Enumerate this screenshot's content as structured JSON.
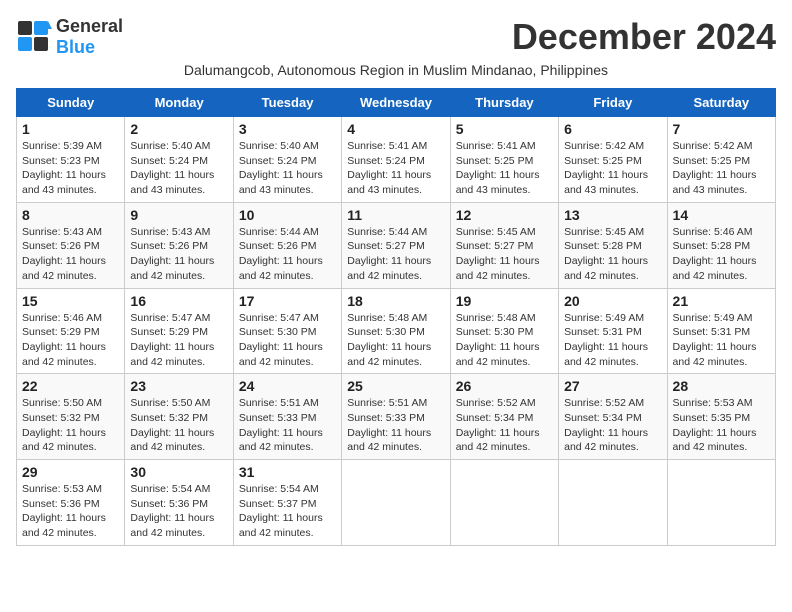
{
  "logo": {
    "general": "General",
    "blue": "Blue"
  },
  "title": "December 2024",
  "subtitle": "Dalumangcob, Autonomous Region in Muslim Mindanao, Philippines",
  "days_header": [
    "Sunday",
    "Monday",
    "Tuesday",
    "Wednesday",
    "Thursday",
    "Friday",
    "Saturday"
  ],
  "weeks": [
    [
      {
        "day": "1",
        "sunrise": "5:39 AM",
        "sunset": "5:23 PM",
        "daylight": "11 hours and 43 minutes."
      },
      {
        "day": "2",
        "sunrise": "5:40 AM",
        "sunset": "5:24 PM",
        "daylight": "11 hours and 43 minutes."
      },
      {
        "day": "3",
        "sunrise": "5:40 AM",
        "sunset": "5:24 PM",
        "daylight": "11 hours and 43 minutes."
      },
      {
        "day": "4",
        "sunrise": "5:41 AM",
        "sunset": "5:24 PM",
        "daylight": "11 hours and 43 minutes."
      },
      {
        "day": "5",
        "sunrise": "5:41 AM",
        "sunset": "5:25 PM",
        "daylight": "11 hours and 43 minutes."
      },
      {
        "day": "6",
        "sunrise": "5:42 AM",
        "sunset": "5:25 PM",
        "daylight": "11 hours and 43 minutes."
      },
      {
        "day": "7",
        "sunrise": "5:42 AM",
        "sunset": "5:25 PM",
        "daylight": "11 hours and 43 minutes."
      }
    ],
    [
      {
        "day": "8",
        "sunrise": "5:43 AM",
        "sunset": "5:26 PM",
        "daylight": "11 hours and 42 minutes."
      },
      {
        "day": "9",
        "sunrise": "5:43 AM",
        "sunset": "5:26 PM",
        "daylight": "11 hours and 42 minutes."
      },
      {
        "day": "10",
        "sunrise": "5:44 AM",
        "sunset": "5:26 PM",
        "daylight": "11 hours and 42 minutes."
      },
      {
        "day": "11",
        "sunrise": "5:44 AM",
        "sunset": "5:27 PM",
        "daylight": "11 hours and 42 minutes."
      },
      {
        "day": "12",
        "sunrise": "5:45 AM",
        "sunset": "5:27 PM",
        "daylight": "11 hours and 42 minutes."
      },
      {
        "day": "13",
        "sunrise": "5:45 AM",
        "sunset": "5:28 PM",
        "daylight": "11 hours and 42 minutes."
      },
      {
        "day": "14",
        "sunrise": "5:46 AM",
        "sunset": "5:28 PM",
        "daylight": "11 hours and 42 minutes."
      }
    ],
    [
      {
        "day": "15",
        "sunrise": "5:46 AM",
        "sunset": "5:29 PM",
        "daylight": "11 hours and 42 minutes."
      },
      {
        "day": "16",
        "sunrise": "5:47 AM",
        "sunset": "5:29 PM",
        "daylight": "11 hours and 42 minutes."
      },
      {
        "day": "17",
        "sunrise": "5:47 AM",
        "sunset": "5:30 PM",
        "daylight": "11 hours and 42 minutes."
      },
      {
        "day": "18",
        "sunrise": "5:48 AM",
        "sunset": "5:30 PM",
        "daylight": "11 hours and 42 minutes."
      },
      {
        "day": "19",
        "sunrise": "5:48 AM",
        "sunset": "5:30 PM",
        "daylight": "11 hours and 42 minutes."
      },
      {
        "day": "20",
        "sunrise": "5:49 AM",
        "sunset": "5:31 PM",
        "daylight": "11 hours and 42 minutes."
      },
      {
        "day": "21",
        "sunrise": "5:49 AM",
        "sunset": "5:31 PM",
        "daylight": "11 hours and 42 minutes."
      }
    ],
    [
      {
        "day": "22",
        "sunrise": "5:50 AM",
        "sunset": "5:32 PM",
        "daylight": "11 hours and 42 minutes."
      },
      {
        "day": "23",
        "sunrise": "5:50 AM",
        "sunset": "5:32 PM",
        "daylight": "11 hours and 42 minutes."
      },
      {
        "day": "24",
        "sunrise": "5:51 AM",
        "sunset": "5:33 PM",
        "daylight": "11 hours and 42 minutes."
      },
      {
        "day": "25",
        "sunrise": "5:51 AM",
        "sunset": "5:33 PM",
        "daylight": "11 hours and 42 minutes."
      },
      {
        "day": "26",
        "sunrise": "5:52 AM",
        "sunset": "5:34 PM",
        "daylight": "11 hours and 42 minutes."
      },
      {
        "day": "27",
        "sunrise": "5:52 AM",
        "sunset": "5:34 PM",
        "daylight": "11 hours and 42 minutes."
      },
      {
        "day": "28",
        "sunrise": "5:53 AM",
        "sunset": "5:35 PM",
        "daylight": "11 hours and 42 minutes."
      }
    ],
    [
      {
        "day": "29",
        "sunrise": "5:53 AM",
        "sunset": "5:36 PM",
        "daylight": "11 hours and 42 minutes."
      },
      {
        "day": "30",
        "sunrise": "5:54 AM",
        "sunset": "5:36 PM",
        "daylight": "11 hours and 42 minutes."
      },
      {
        "day": "31",
        "sunrise": "5:54 AM",
        "sunset": "5:37 PM",
        "daylight": "11 hours and 42 minutes."
      },
      null,
      null,
      null,
      null
    ]
  ]
}
